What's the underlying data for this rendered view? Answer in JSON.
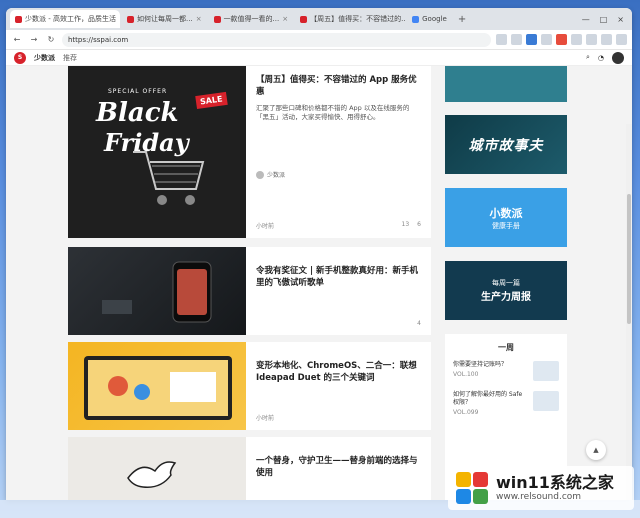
{
  "browser": {
    "tabs": [
      {
        "label": "少数派 - 高效工作，品质生活",
        "active": true
      },
      {
        "label": "如何让每周一都..."
      },
      {
        "label": "一款值得一看的..."
      },
      {
        "label": "【周五】值得买：不容错过的..."
      },
      {
        "label": "Google"
      }
    ],
    "new_tab_label": "+",
    "tab_close": "×",
    "window_controls": [
      "—",
      "□",
      "×"
    ],
    "back": "←",
    "forward": "→",
    "reload": "↻",
    "address": "https://sspai.com"
  },
  "site": {
    "logo_text": "S",
    "brand": "少数派",
    "nav": [
      "推荐"
    ]
  },
  "articles": [
    {
      "title": "【周五】值得买：不容错过的 App 服务优惠",
      "excerpt": "汇聚了那些口碑和价格都不错的 App 以及在线服务的「黑五」活动，大家买得愉快、用得舒心。",
      "author": "少数派",
      "time": "小时前",
      "likes": "13",
      "comments": "6",
      "thumb": {
        "special": "SPECIAL OFFER",
        "line1": "Black",
        "line2": "Friday",
        "sale": "SALE"
      }
    },
    {
      "title": "令我有奖征文 | 新手机整款真好用：新手机里的飞傲试听歌单",
      "excerpt": "",
      "author": "",
      "time": "",
      "likes": "",
      "comments": "4"
    },
    {
      "title": "变形本地化、ChromeOS、二合一：联想 Ideapad Duet 的三个关键词",
      "excerpt": "",
      "author": "",
      "time": "小时前",
      "likes": "",
      "comments": ""
    },
    {
      "title": "一个替身，守护卫生——替身前端的选择与使用",
      "excerpt": "",
      "author": "",
      "time": "",
      "likes": "",
      "comments": ""
    }
  ],
  "sidebar": {
    "banner2": "城市故事夫",
    "banner3_title": "小数派",
    "banner3_sub": "健康手册",
    "banner4_title": "每周一篇",
    "banner4_sub": "生产力周报",
    "recommend_title": "一周",
    "items": [
      {
        "text": "你需要坚持记账吗？",
        "vol": "VOL.100"
      },
      {
        "text": "如何了解你最好用的 Safe 权限？",
        "vol": "VOL.099"
      }
    ]
  },
  "watermark": {
    "title": "win11系统之家",
    "url": "www.relsound.com"
  },
  "colors": {
    "brand_red": "#d7222b",
    "desktop_blue": "#5a8fe0"
  }
}
